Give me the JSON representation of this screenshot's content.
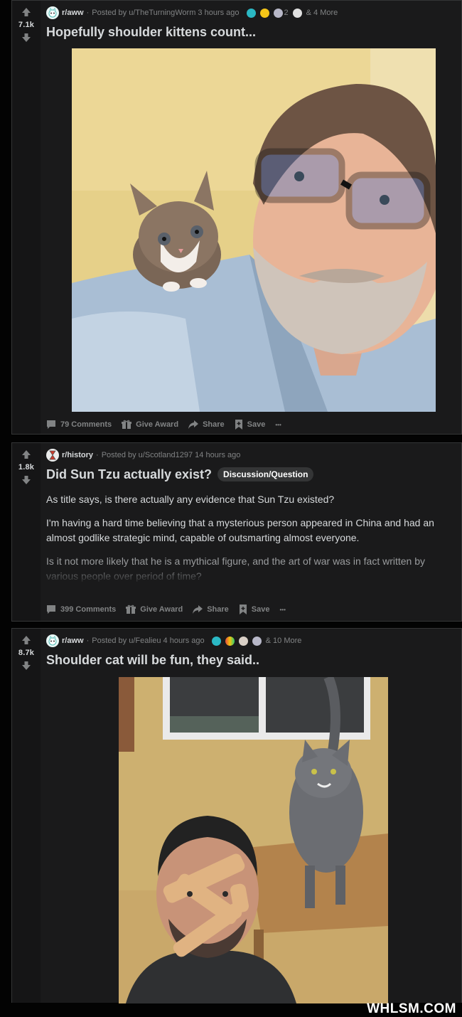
{
  "posts": [
    {
      "score": "7.1k",
      "subreddit": "r/aww",
      "posted_by": "Posted by u/TheTurningWorm 3 hours ago",
      "award_count": "2",
      "more_awards": "& 4 More",
      "title": "Hopefully shoulder kittens count...",
      "comments": "79 Comments",
      "give_award": "Give Award",
      "share": "Share",
      "save": "Save",
      "more": "•••"
    },
    {
      "score": "1.8k",
      "subreddit": "r/history",
      "posted_by": "Posted by u/Scotland1297 14 hours ago",
      "title": "Did Sun Tzu actually exist?",
      "flair": "Discussion/Question",
      "body": [
        "As title says, is there actually any evidence that Sun Tzu existed?",
        "I'm having a hard time believing that a mysterious person appeared in China and had an almost godlike strategic mind, capable of outsmarting almost everyone.",
        "Is it not more likely that he is a mythical figure, and the art of war was in fact written by various people over period of time?"
      ],
      "comments": "399 Comments",
      "give_award": "Give Award",
      "share": "Share",
      "save": "Save",
      "more": "•••"
    },
    {
      "score": "8.7k",
      "subreddit": "r/aww",
      "posted_by": "Posted by u/Fealieu 4 hours ago",
      "more_awards": "& 10 More",
      "title": "Shoulder cat will be fun, they said.."
    }
  ],
  "watermark": "WHLSM.COM",
  "colors": {
    "bg": "#030303",
    "card": "#1a1a1b",
    "text": "#d7dadc",
    "meta": "#818384"
  }
}
